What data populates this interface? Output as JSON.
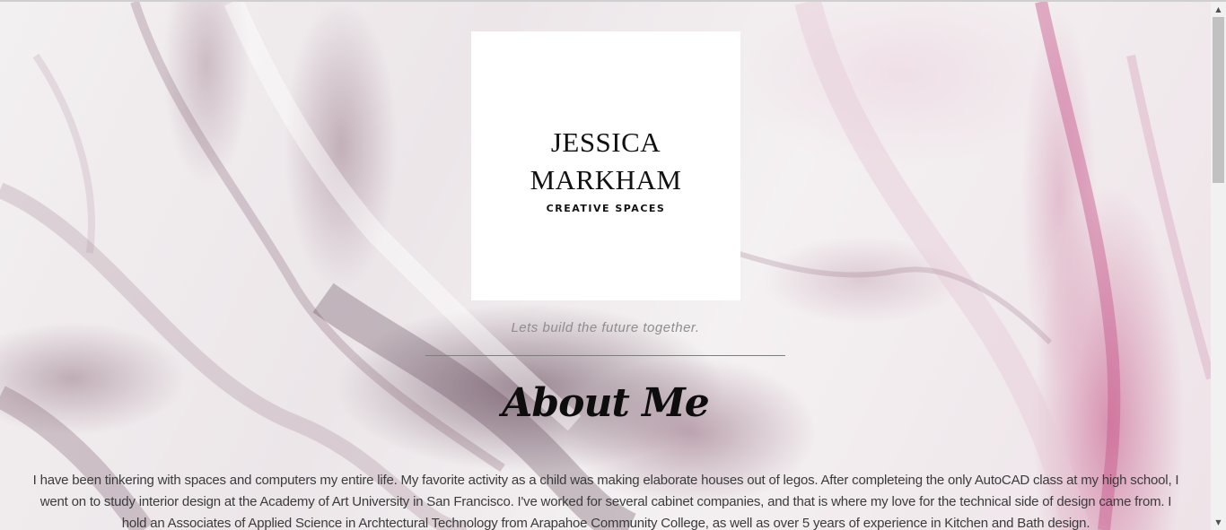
{
  "logo": {
    "name_line1": "JESSICA",
    "name_line2": "MARKHAM",
    "subtitle": "CREATIVE SPACES"
  },
  "tagline": "Lets build the future together.",
  "about": {
    "title": "About Me",
    "body": "I have been tinkering with spaces and computers my entire life. My favorite activity as a child was making elaborate houses out of legos. After completeing the only AutoCAD class at my high school, I went on to study interior design at the Academy of Art University in San Francisco. I've worked for several cabinet companies, and that is where my love for the technical side of design came from. I hold an Associates of Applied Science in Archtectural Technology from Arapahoe Community College, as well as over 5 years of experience in Kitchen and Bath design."
  },
  "scrollbar": {
    "up_icon": "triangle-up",
    "down_icon": "triangle-down"
  },
  "colors": {
    "background_base": "#f1eeef",
    "marble_pink": "#c4508a",
    "marble_mauve": "#624456",
    "text_dark": "#0d0d0d",
    "tagline_gray": "#8f8d8e"
  }
}
